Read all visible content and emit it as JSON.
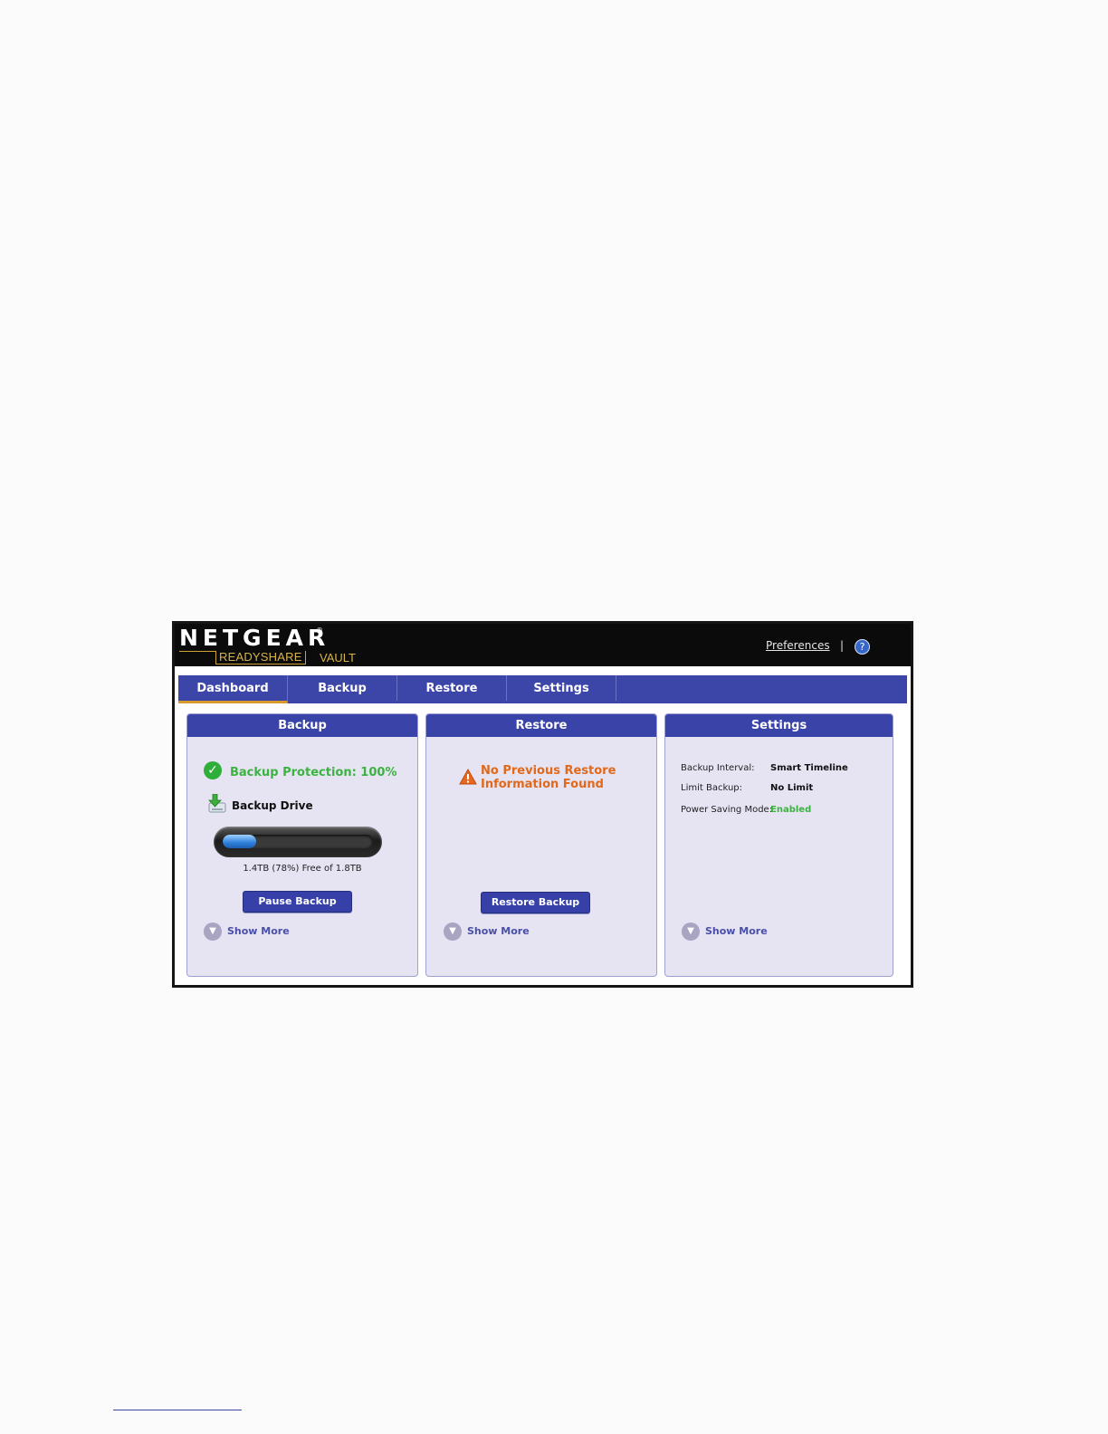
{
  "header": {
    "brand": "NETGEAR",
    "brand_mark": "®",
    "subbrand": "READYSHARE",
    "subbrand_suffix": "VAULT",
    "preferences_link": "Preferences",
    "separator": "|",
    "help_symbol": "?"
  },
  "tabs": [
    {
      "label": "Dashboard",
      "active": true
    },
    {
      "label": "Backup",
      "active": false
    },
    {
      "label": "Restore",
      "active": false
    },
    {
      "label": "Settings",
      "active": false
    }
  ],
  "panels": {
    "backup": {
      "title": "Backup",
      "protection_status": "Backup Protection: 100%",
      "drive_label": "Backup Drive",
      "storage_used_fraction": 0.22,
      "storage_text": "1.4TB (78%) Free of 1.8TB",
      "pause_button": "Pause Backup",
      "show_more": "Show More"
    },
    "restore": {
      "title": "Restore",
      "warning_line1": "No Previous Restore",
      "warning_line2": "Information Found",
      "restore_button": "Restore Backup",
      "show_more": "Show More"
    },
    "settings": {
      "title": "Settings",
      "backup_interval_label": "Backup Interval:",
      "backup_interval_value": "Smart Timeline",
      "limit_backup_label": "Limit Backup:",
      "limit_backup_value": "No Limit",
      "power_saving_label": "Power Saving Mode:",
      "power_saving_value": "Enabled",
      "show_more": "Show More"
    }
  },
  "colors": {
    "accent": "#3a44a8",
    "ok_green": "#3cb340",
    "warning_orange": "#e0691c",
    "tab_underline": "#d89a2a"
  }
}
